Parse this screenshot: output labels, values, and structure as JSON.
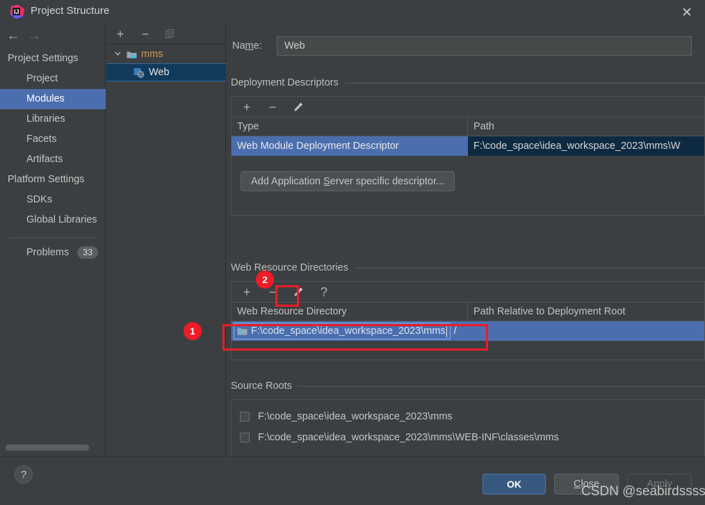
{
  "window": {
    "title": "Project Structure",
    "app_icon": "intellij-idea-logo",
    "close_icon": "✕"
  },
  "nav": {
    "back_icon": "←",
    "forward_icon": "→"
  },
  "sidebar": {
    "groups": [
      {
        "label": "Project Settings",
        "type": "group"
      },
      {
        "label": "Project",
        "type": "leaf",
        "selected": false
      },
      {
        "label": "Modules",
        "type": "leaf",
        "selected": true
      },
      {
        "label": "Libraries",
        "type": "leaf",
        "selected": false
      },
      {
        "label": "Facets",
        "type": "leaf",
        "selected": false
      },
      {
        "label": "Artifacts",
        "type": "leaf",
        "selected": false
      },
      {
        "label": "Platform Settings",
        "type": "group"
      },
      {
        "label": "SDKs",
        "type": "leaf",
        "selected": false
      },
      {
        "label": "Global Libraries",
        "type": "leaf",
        "selected": false
      }
    ],
    "problems": {
      "label": "Problems",
      "count": "33"
    }
  },
  "tree": {
    "toolbar": [
      {
        "name": "add",
        "glyph": "+",
        "disabled": false
      },
      {
        "name": "remove",
        "glyph": "−",
        "disabled": false
      },
      {
        "name": "copy",
        "glyph": "❐",
        "disabled": true
      }
    ],
    "nodes": [
      {
        "label": "mms",
        "icon": "module-folder-icon",
        "expanded": true,
        "selected": false
      },
      {
        "label": "Web",
        "icon": "web-facet-icon",
        "expanded": false,
        "selected": true
      }
    ],
    "chevron": "⌄"
  },
  "main": {
    "name_field": {
      "label_prefix": "Na",
      "label_mnemonic": "m",
      "label_suffix": "e:",
      "value": "Web",
      "placeholder": ""
    },
    "deployment_descriptors": {
      "title": "Deployment Descriptors",
      "toolbar": [
        {
          "name": "add",
          "glyph": "+"
        },
        {
          "name": "remove",
          "glyph": "−"
        },
        {
          "name": "edit",
          "glyph": "pencil"
        }
      ],
      "columns": [
        "Type",
        "Path"
      ],
      "rows": [
        {
          "type": "Web Module Deployment Descriptor",
          "path": "F:\\code_space\\idea_workspace_2023\\mms\\W",
          "selected": true
        }
      ],
      "add_button": {
        "prefix": "Add Application ",
        "mnemonic": "S",
        "suffix": "erver specific descriptor..."
      }
    },
    "web_resource_directories": {
      "title": "Web Resource Directories",
      "toolbar": [
        {
          "name": "add",
          "glyph": "+"
        },
        {
          "name": "remove",
          "glyph": "−"
        },
        {
          "name": "edit",
          "glyph": "pencil"
        },
        {
          "name": "help",
          "glyph": "?"
        }
      ],
      "columns": [
        "Web Resource Directory",
        "Path Relative to Deployment Root"
      ],
      "rows": [
        {
          "directory": "F:\\code_space\\idea_workspace_2023\\mms",
          "relative_path": "/",
          "editing": true,
          "selected": true
        }
      ]
    },
    "source_roots": {
      "title": "Source Roots",
      "items": [
        {
          "path": "F:\\code_space\\idea_workspace_2023\\mms",
          "checked": false
        },
        {
          "path": "F:\\code_space\\idea_workspace_2023\\mms\\WEB-INF\\classes\\mms",
          "checked": false
        }
      ]
    }
  },
  "footer": {
    "help_icon": "?",
    "ok": "OK",
    "close_prefix": "",
    "close_mnemonic": "C",
    "close_suffix": "lose",
    "apply": "Apply",
    "watermark": "CSDN @seabirdssss"
  },
  "annotations": [
    {
      "label": "1"
    },
    {
      "label": "2"
    }
  ],
  "colors": {
    "accent_selection": "#4b6eaf",
    "tree_selection": "#113a5c",
    "annotation_red": "#ee1c25",
    "ok_button": "#365880",
    "module_text": "#d09a58"
  }
}
